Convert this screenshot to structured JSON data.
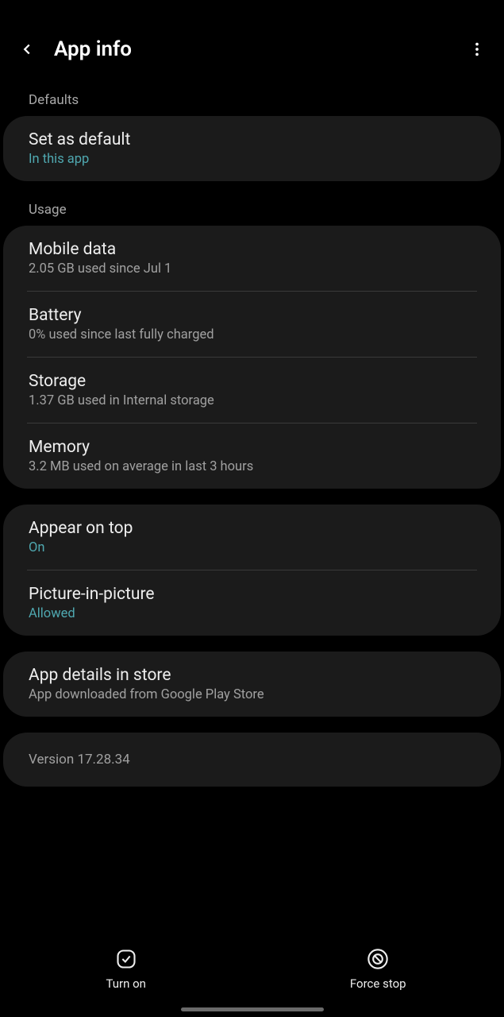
{
  "header": {
    "title": "App info"
  },
  "sections": {
    "defaults": {
      "header": "Defaults",
      "setAsDefault": {
        "title": "Set as default",
        "subtitle": "In this app"
      }
    },
    "usage": {
      "header": "Usage",
      "mobileData": {
        "title": "Mobile data",
        "subtitle": "2.05 GB used since Jul 1"
      },
      "battery": {
        "title": "Battery",
        "subtitle": "0% used since last fully charged"
      },
      "storage": {
        "title": "Storage",
        "subtitle": "1.37 GB used in Internal storage"
      },
      "memory": {
        "title": "Memory",
        "subtitle": "3.2 MB used on average in last 3 hours"
      }
    },
    "permissions": {
      "appearOnTop": {
        "title": "Appear on top",
        "subtitle": "On"
      },
      "pictureInPicture": {
        "title": "Picture-in-picture",
        "subtitle": "Allowed"
      }
    },
    "store": {
      "title": "App details in store",
      "subtitle": "App downloaded from Google Play Store"
    },
    "version": "Version 17.28.34"
  },
  "bottomBar": {
    "turnOn": "Turn on",
    "forceStop": "Force stop"
  }
}
